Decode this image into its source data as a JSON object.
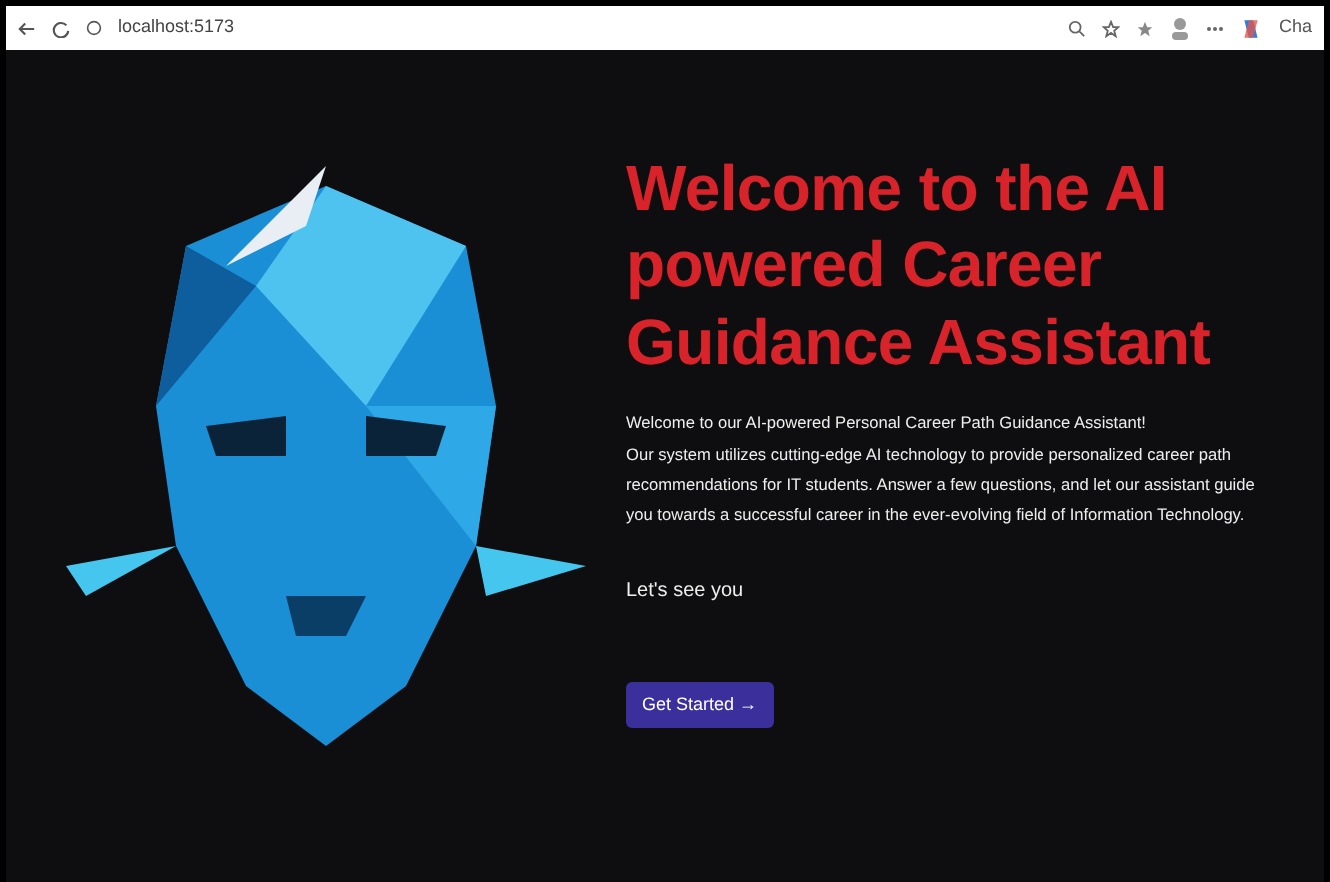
{
  "browser": {
    "url": "localhost:5173",
    "copilot_label": "Cha"
  },
  "hero": {
    "heading": "Welcome to the AI powered Career Guidance Assistant",
    "paragraphs": [
      "Welcome to our AI-powered Personal Career Path Guidance Assistant!",
      "Our system utilizes cutting-edge AI technology to provide personalized career path recommendations for IT students. Answer a few questions, and let our assistant guide you towards a successful career in the ever-evolving field of Information Technology."
    ],
    "subheading": "Let's see you",
    "button": "Get Started →"
  }
}
